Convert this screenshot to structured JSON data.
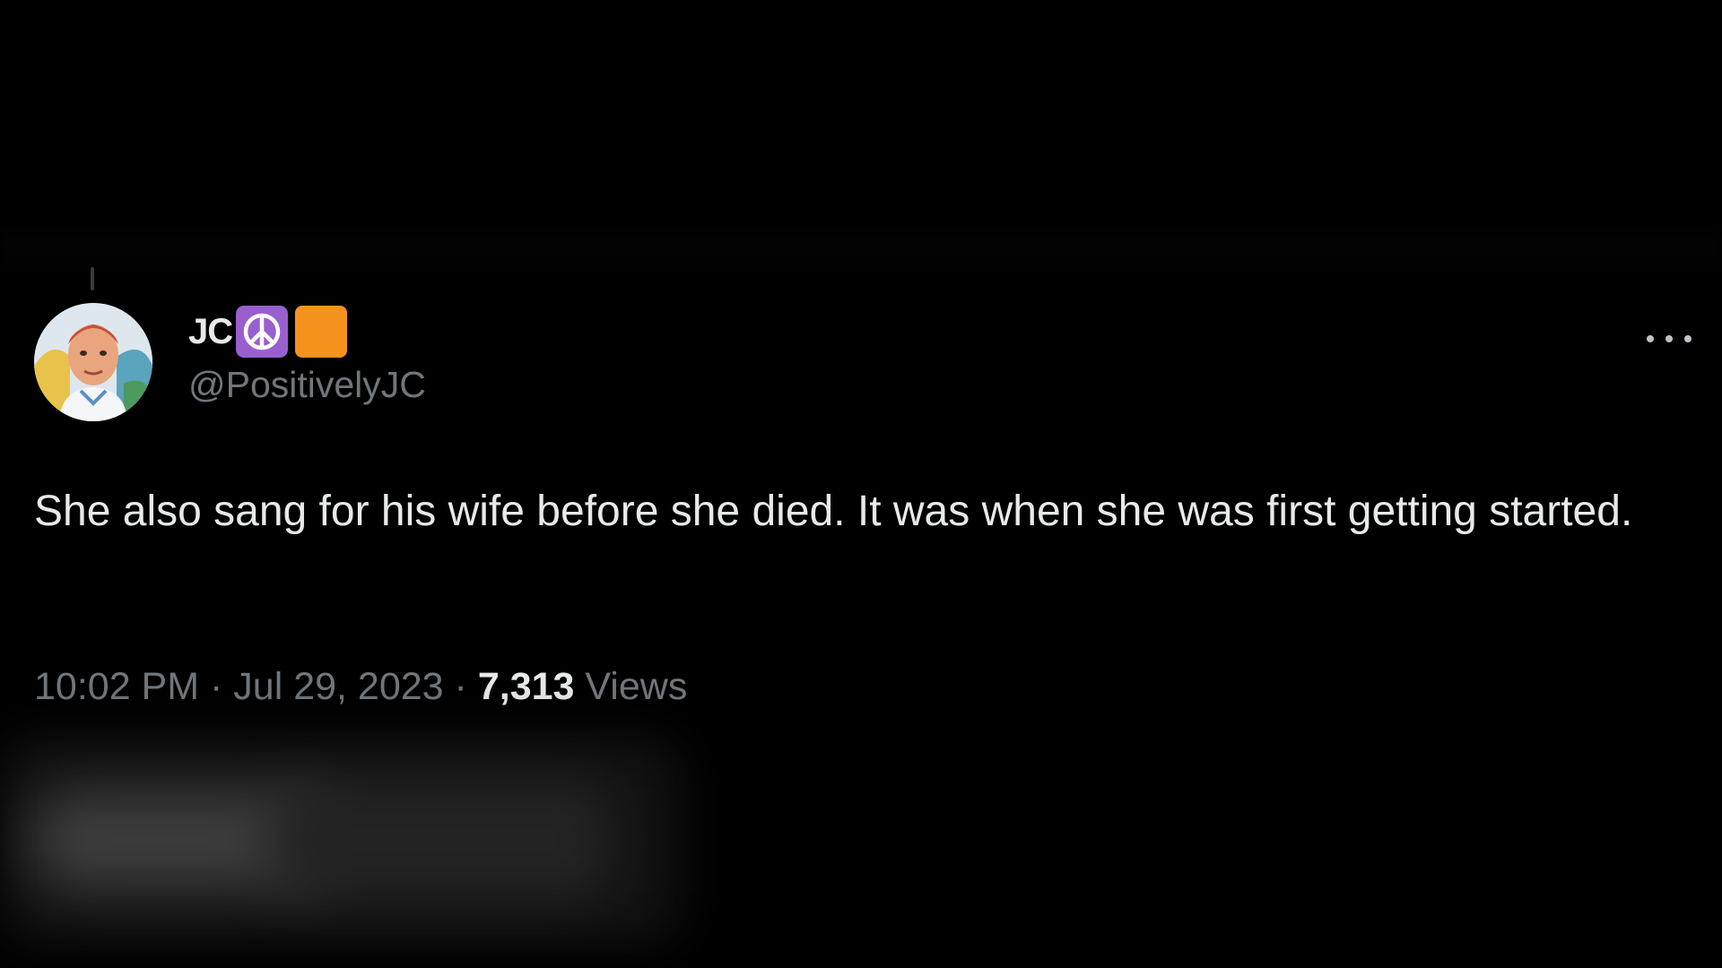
{
  "tweet": {
    "author": {
      "display_name": "JC",
      "badges": [
        "peace-symbol-emoji",
        "orange-square-emoji"
      ],
      "peace_symbol": "☮",
      "handle": "@PositivelyJC"
    },
    "text": "She also sang for his wife before she died. It was when she was first getting started.",
    "time": "10:02 PM",
    "date": "Jul 29, 2023",
    "separator": "·",
    "views_count": "7,313",
    "views_label": "Views",
    "more_icon": "ellipsis-icon"
  },
  "colors": {
    "background": "#000000",
    "primary_text": "#e7e9ea",
    "secondary_text": "#71767b",
    "peace_badge": "#9a5fcf",
    "orange_badge": "#f6921e"
  }
}
